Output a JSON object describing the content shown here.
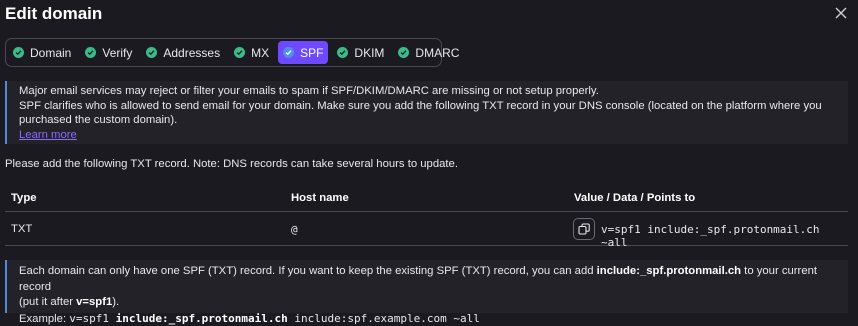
{
  "modal": {
    "title": "Edit domain",
    "close_icon": "close-icon"
  },
  "tabs": [
    {
      "label": "Domain",
      "icon": "check-circle-icon",
      "active": false
    },
    {
      "label": "Verify",
      "icon": "check-circle-icon",
      "active": false
    },
    {
      "label": "Addresses",
      "icon": "check-circle-icon",
      "active": false
    },
    {
      "label": "MX",
      "icon": "check-circle-icon",
      "active": false
    },
    {
      "label": "SPF",
      "icon": "check-circle-icon",
      "active": true
    },
    {
      "label": "DKIM",
      "icon": "check-circle-icon",
      "active": false
    },
    {
      "label": "DMARC",
      "icon": "check-circle-icon",
      "active": false
    }
  ],
  "info": {
    "line1": "Major email services may reject or filter your emails to spam if SPF/DKIM/DMARC are missing or not setup properly.",
    "line2": "SPF clarifies who is allowed to send email for your domain. Make sure you add the following TXT record in your DNS console (located on the platform where you",
    "line3": "purchased the custom domain).",
    "learn_more": "Learn more"
  },
  "note": "Please add the following TXT record. Note: DNS records can take several hours to update.",
  "table": {
    "headers": {
      "type": "Type",
      "host": "Host name",
      "value": "Value / Data / Points to"
    },
    "row": {
      "type": "TXT",
      "host": "@",
      "value": "v=spf1 include:_spf.protonmail.ch ~all"
    }
  },
  "warning": {
    "part1": "Each domain can only have one SPF (TXT) record. If you want to keep the existing SPF (TXT) record, you can add ",
    "bold1": "include:_spf.protonmail.ch",
    "part2": " to your current record",
    "part3": "(put it after ",
    "bold2": "v=spf1",
    "part4": ").",
    "example_label": "Example: ",
    "example_prefix": "v=spf1 ",
    "example_bold": "include:_spf.protonmail.ch",
    "example_suffix": " include:spf.example.com ~all"
  },
  "colors": {
    "accent": "#6d4aff",
    "success": "#3bbb8a",
    "info_border": "#4f8bd6",
    "background": "#1b1a20"
  }
}
